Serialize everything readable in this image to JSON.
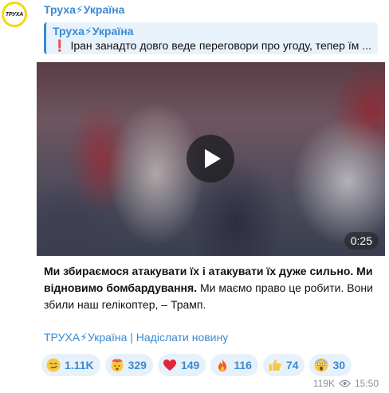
{
  "avatar": {
    "label": "ТРУХА"
  },
  "channel": {
    "title": "Труха⚡Україна"
  },
  "reply": {
    "title": "Труха⚡Україна",
    "mark": "❗",
    "text": "Іран занадто довго веде переговори про угоду, тепер їм ..."
  },
  "video": {
    "duration": "0:25"
  },
  "message": {
    "bold_text": "Ми збираємося атакувати їх і атакувати їх дуже сильно. Ми відновимо бомбардування.",
    "regular_text": " Ми маємо право це робити. Вони збили наш гелікоптер, – Трамп."
  },
  "footer": {
    "links": "ТРУХА⚡Україна | Надіслати новину"
  },
  "reactions": [
    {
      "icon": "smirk-face-icon",
      "count": "1.11K"
    },
    {
      "icon": "exploding-head-icon",
      "count": "329"
    },
    {
      "icon": "red-heart-icon",
      "count": "149"
    },
    {
      "icon": "fire-icon",
      "count": "116"
    },
    {
      "icon": "thumbs-up-icon",
      "count": "74"
    },
    {
      "icon": "screaming-face-icon",
      "count": "30"
    }
  ],
  "meta": {
    "views": "119K",
    "time": "15:50"
  },
  "colors": {
    "accent": "#3a8ad2",
    "reaction_bg": "#e7f1fa",
    "reply_bg": "#e8f2fb",
    "avatar_ring": "#f5d90a"
  }
}
